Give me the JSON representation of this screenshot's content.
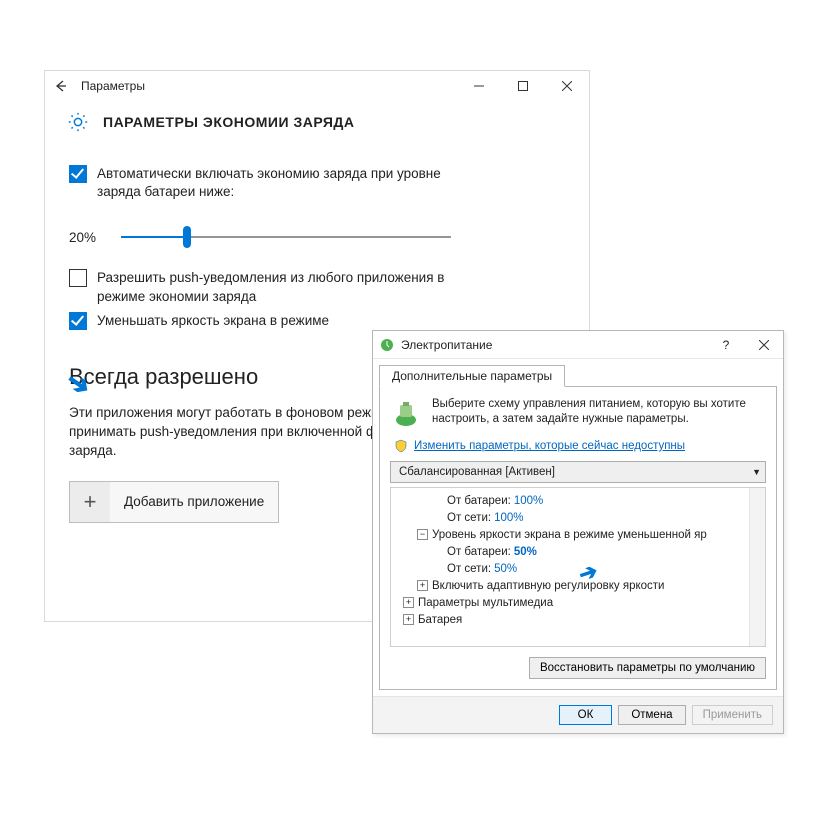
{
  "settings": {
    "title": "Параметры",
    "header": "ПАРАМЕТРЫ ЭКОНОМИИ ЗАРЯДА",
    "auto_enable_label": "Автоматически включать экономию заряда при уровне заряда батареи ниже:",
    "threshold": "20%",
    "push_label": "Разрешить push-уведомления из любого приложения в режиме экономии заряда",
    "dim_label": "Уменьшать яркость экрана в режиме",
    "section_title": "Всегда разрешено",
    "section_text": "Эти приложения могут работать в фоновом режиме, отправлять и принимать push-уведомления при включенной функции экономии заряда.",
    "add_button": "Добавить приложение"
  },
  "power": {
    "title": "Электропитание",
    "tab": "Дополнительные параметры",
    "description": "Выберите схему управления питанием, которую вы хотите настроить, а затем задайте нужные параметры.",
    "link": "Изменить параметры, которые сейчас недоступны",
    "plan": "Сбалансированная [Активен]",
    "tree": {
      "row1_label": "От батареи:",
      "row1_value": "100%",
      "row2_label": "От сети:",
      "row2_value": "100%",
      "row3_label": "Уровень яркости экрана в режиме уменьшенной яр",
      "row4_label": "От батареи:",
      "row4_value": "50%",
      "row5_label": "От сети:",
      "row5_value": "50%",
      "row6_label": "Включить адаптивную регулировку яркости",
      "row7_label": "Параметры мультимедиа",
      "row8_label": "Батарея"
    },
    "restore": "Восстановить параметры по умолчанию",
    "ok": "ОК",
    "cancel": "Отмена",
    "apply": "Применить"
  }
}
